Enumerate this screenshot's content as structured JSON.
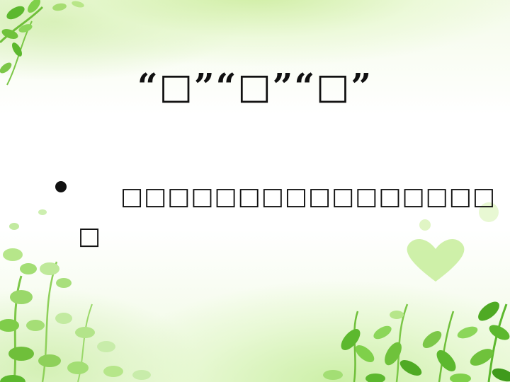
{
  "slide": {
    "title": "“□”“□”“□”",
    "bullet_text": "□□□□□□□□□□□□□□□□□"
  },
  "colors": {
    "leaf_dark": "#5cb82e",
    "leaf_light": "#9ad85a",
    "background_tint": "#e6f7d0",
    "text": "#111111"
  }
}
